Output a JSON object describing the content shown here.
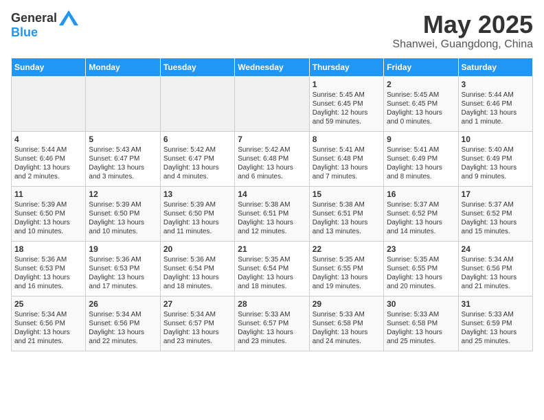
{
  "logo": {
    "general": "General",
    "blue": "Blue"
  },
  "title": "May 2025",
  "subtitle": "Shanwei, Guangdong, China",
  "weekdays": [
    "Sunday",
    "Monday",
    "Tuesday",
    "Wednesday",
    "Thursday",
    "Friday",
    "Saturday"
  ],
  "weeks": [
    [
      {
        "day": "",
        "empty": true
      },
      {
        "day": "",
        "empty": true
      },
      {
        "day": "",
        "empty": true
      },
      {
        "day": "",
        "empty": true
      },
      {
        "day": "1",
        "sunrise": "Sunrise: 5:45 AM",
        "sunset": "Sunset: 6:45 PM",
        "daylight": "Daylight: 12 hours and 59 minutes."
      },
      {
        "day": "2",
        "sunrise": "Sunrise: 5:45 AM",
        "sunset": "Sunset: 6:45 PM",
        "daylight": "Daylight: 13 hours and 0 minutes."
      },
      {
        "day": "3",
        "sunrise": "Sunrise: 5:44 AM",
        "sunset": "Sunset: 6:46 PM",
        "daylight": "Daylight: 13 hours and 1 minute."
      }
    ],
    [
      {
        "day": "4",
        "sunrise": "Sunrise: 5:44 AM",
        "sunset": "Sunset: 6:46 PM",
        "daylight": "Daylight: 13 hours and 2 minutes."
      },
      {
        "day": "5",
        "sunrise": "Sunrise: 5:43 AM",
        "sunset": "Sunset: 6:47 PM",
        "daylight": "Daylight: 13 hours and 3 minutes."
      },
      {
        "day": "6",
        "sunrise": "Sunrise: 5:42 AM",
        "sunset": "Sunset: 6:47 PM",
        "daylight": "Daylight: 13 hours and 4 minutes."
      },
      {
        "day": "7",
        "sunrise": "Sunrise: 5:42 AM",
        "sunset": "Sunset: 6:48 PM",
        "daylight": "Daylight: 13 hours and 6 minutes."
      },
      {
        "day": "8",
        "sunrise": "Sunrise: 5:41 AM",
        "sunset": "Sunset: 6:48 PM",
        "daylight": "Daylight: 13 hours and 7 minutes."
      },
      {
        "day": "9",
        "sunrise": "Sunrise: 5:41 AM",
        "sunset": "Sunset: 6:49 PM",
        "daylight": "Daylight: 13 hours and 8 minutes."
      },
      {
        "day": "10",
        "sunrise": "Sunrise: 5:40 AM",
        "sunset": "Sunset: 6:49 PM",
        "daylight": "Daylight: 13 hours and 9 minutes."
      }
    ],
    [
      {
        "day": "11",
        "sunrise": "Sunrise: 5:39 AM",
        "sunset": "Sunset: 6:50 PM",
        "daylight": "Daylight: 13 hours and 10 minutes."
      },
      {
        "day": "12",
        "sunrise": "Sunrise: 5:39 AM",
        "sunset": "Sunset: 6:50 PM",
        "daylight": "Daylight: 13 hours and 10 minutes."
      },
      {
        "day": "13",
        "sunrise": "Sunrise: 5:39 AM",
        "sunset": "Sunset: 6:50 PM",
        "daylight": "Daylight: 13 hours and 11 minutes."
      },
      {
        "day": "14",
        "sunrise": "Sunrise: 5:38 AM",
        "sunset": "Sunset: 6:51 PM",
        "daylight": "Daylight: 13 hours and 12 minutes."
      },
      {
        "day": "15",
        "sunrise": "Sunrise: 5:38 AM",
        "sunset": "Sunset: 6:51 PM",
        "daylight": "Daylight: 13 hours and 13 minutes."
      },
      {
        "day": "16",
        "sunrise": "Sunrise: 5:37 AM",
        "sunset": "Sunset: 6:52 PM",
        "daylight": "Daylight: 13 hours and 14 minutes."
      },
      {
        "day": "17",
        "sunrise": "Sunrise: 5:37 AM",
        "sunset": "Sunset: 6:52 PM",
        "daylight": "Daylight: 13 hours and 15 minutes."
      }
    ],
    [
      {
        "day": "18",
        "sunrise": "Sunrise: 5:36 AM",
        "sunset": "Sunset: 6:53 PM",
        "daylight": "Daylight: 13 hours and 16 minutes."
      },
      {
        "day": "19",
        "sunrise": "Sunrise: 5:36 AM",
        "sunset": "Sunset: 6:53 PM",
        "daylight": "Daylight: 13 hours and 17 minutes."
      },
      {
        "day": "20",
        "sunrise": "Sunrise: 5:36 AM",
        "sunset": "Sunset: 6:54 PM",
        "daylight": "Daylight: 13 hours and 18 minutes."
      },
      {
        "day": "21",
        "sunrise": "Sunrise: 5:35 AM",
        "sunset": "Sunset: 6:54 PM",
        "daylight": "Daylight: 13 hours and 18 minutes."
      },
      {
        "day": "22",
        "sunrise": "Sunrise: 5:35 AM",
        "sunset": "Sunset: 6:55 PM",
        "daylight": "Daylight: 13 hours and 19 minutes."
      },
      {
        "day": "23",
        "sunrise": "Sunrise: 5:35 AM",
        "sunset": "Sunset: 6:55 PM",
        "daylight": "Daylight: 13 hours and 20 minutes."
      },
      {
        "day": "24",
        "sunrise": "Sunrise: 5:34 AM",
        "sunset": "Sunset: 6:56 PM",
        "daylight": "Daylight: 13 hours and 21 minutes."
      }
    ],
    [
      {
        "day": "25",
        "sunrise": "Sunrise: 5:34 AM",
        "sunset": "Sunset: 6:56 PM",
        "daylight": "Daylight: 13 hours and 21 minutes."
      },
      {
        "day": "26",
        "sunrise": "Sunrise: 5:34 AM",
        "sunset": "Sunset: 6:56 PM",
        "daylight": "Daylight: 13 hours and 22 minutes."
      },
      {
        "day": "27",
        "sunrise": "Sunrise: 5:34 AM",
        "sunset": "Sunset: 6:57 PM",
        "daylight": "Daylight: 13 hours and 23 minutes."
      },
      {
        "day": "28",
        "sunrise": "Sunrise: 5:33 AM",
        "sunset": "Sunset: 6:57 PM",
        "daylight": "Daylight: 13 hours and 23 minutes."
      },
      {
        "day": "29",
        "sunrise": "Sunrise: 5:33 AM",
        "sunset": "Sunset: 6:58 PM",
        "daylight": "Daylight: 13 hours and 24 minutes."
      },
      {
        "day": "30",
        "sunrise": "Sunrise: 5:33 AM",
        "sunset": "Sunset: 6:58 PM",
        "daylight": "Daylight: 13 hours and 25 minutes."
      },
      {
        "day": "31",
        "sunrise": "Sunrise: 5:33 AM",
        "sunset": "Sunset: 6:59 PM",
        "daylight": "Daylight: 13 hours and 25 minutes."
      }
    ]
  ]
}
